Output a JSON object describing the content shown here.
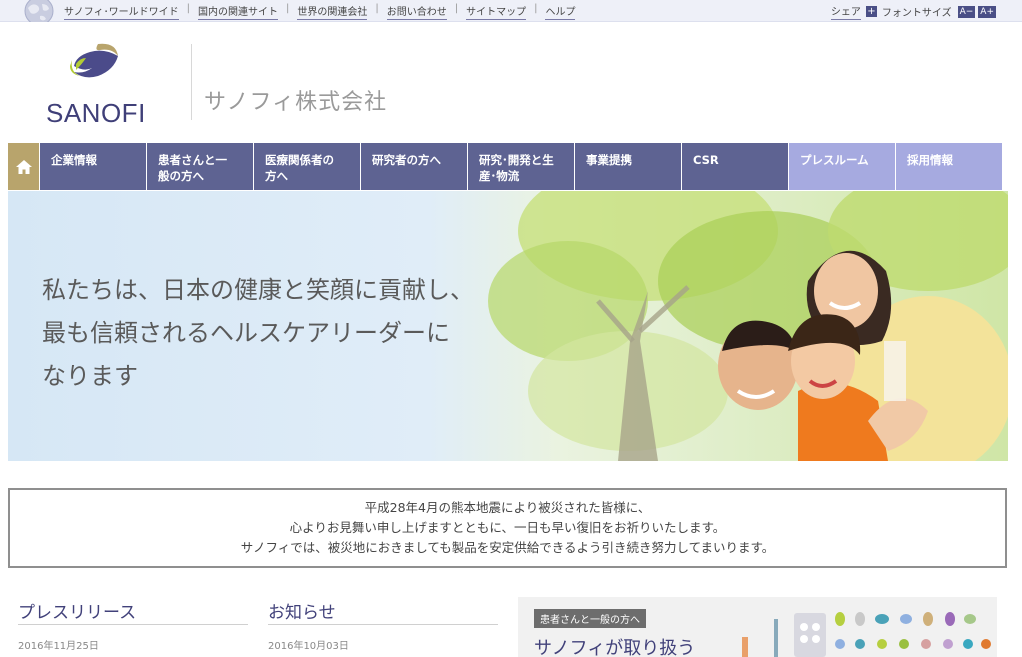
{
  "topbar": {
    "links": [
      "サノフィ･ワールドワイド",
      "国内の関連サイト",
      "世界の関連会社",
      "お問い合わせ",
      "サイトマップ",
      "ヘルプ"
    ],
    "share": "シェア",
    "font_size": "フォントサイズ",
    "font_small": "A−",
    "font_large": "A+"
  },
  "header": {
    "logo_text": "SANOFI",
    "company_name": "サノフィ株式会社"
  },
  "nav": {
    "items": [
      {
        "line1": "企業情報",
        "line2": ""
      },
      {
        "line1": "患者さんと一",
        "line2": "般の方へ"
      },
      {
        "line1": "医療関係者の",
        "line2": "方へ"
      },
      {
        "line1": "研究者の方へ",
        "line2": ""
      },
      {
        "line1": "研究･開発と生",
        "line2": "産･物流"
      },
      {
        "line1": "事業提携",
        "line2": ""
      },
      {
        "line1": "CSR",
        "line2": ""
      },
      {
        "line1": "プレスルーム",
        "line2": ""
      },
      {
        "line1": "採用情報",
        "line2": ""
      }
    ]
  },
  "hero": {
    "line1": "私たちは、日本の健康と笑顔に貢献し、",
    "line2": "最も信頼されるヘルスケアリーダーに",
    "line3": "なります"
  },
  "notice": {
    "line1": "平成28年4月の熊本地震により被災された皆様に、",
    "line2": "心よりお見舞い申し上げますとともに、一日も早い復旧をお祈りいたします。",
    "line3": "サノフィでは、被災地におきましても製品を安定供給できるよう引き続き努力してまいります。"
  },
  "press": {
    "title": "プレスリリース",
    "date": "2016年11月25日"
  },
  "news": {
    "title": "お知らせ",
    "date": "2016年10月03日"
  },
  "promo": {
    "tag": "患者さんと一般の方へ",
    "title": "サノフィが取り扱う"
  },
  "colors": {
    "nav": "#5e6392",
    "nav_light": "#a6aae0",
    "home": "#b8a46c",
    "brand": "#41417a"
  }
}
